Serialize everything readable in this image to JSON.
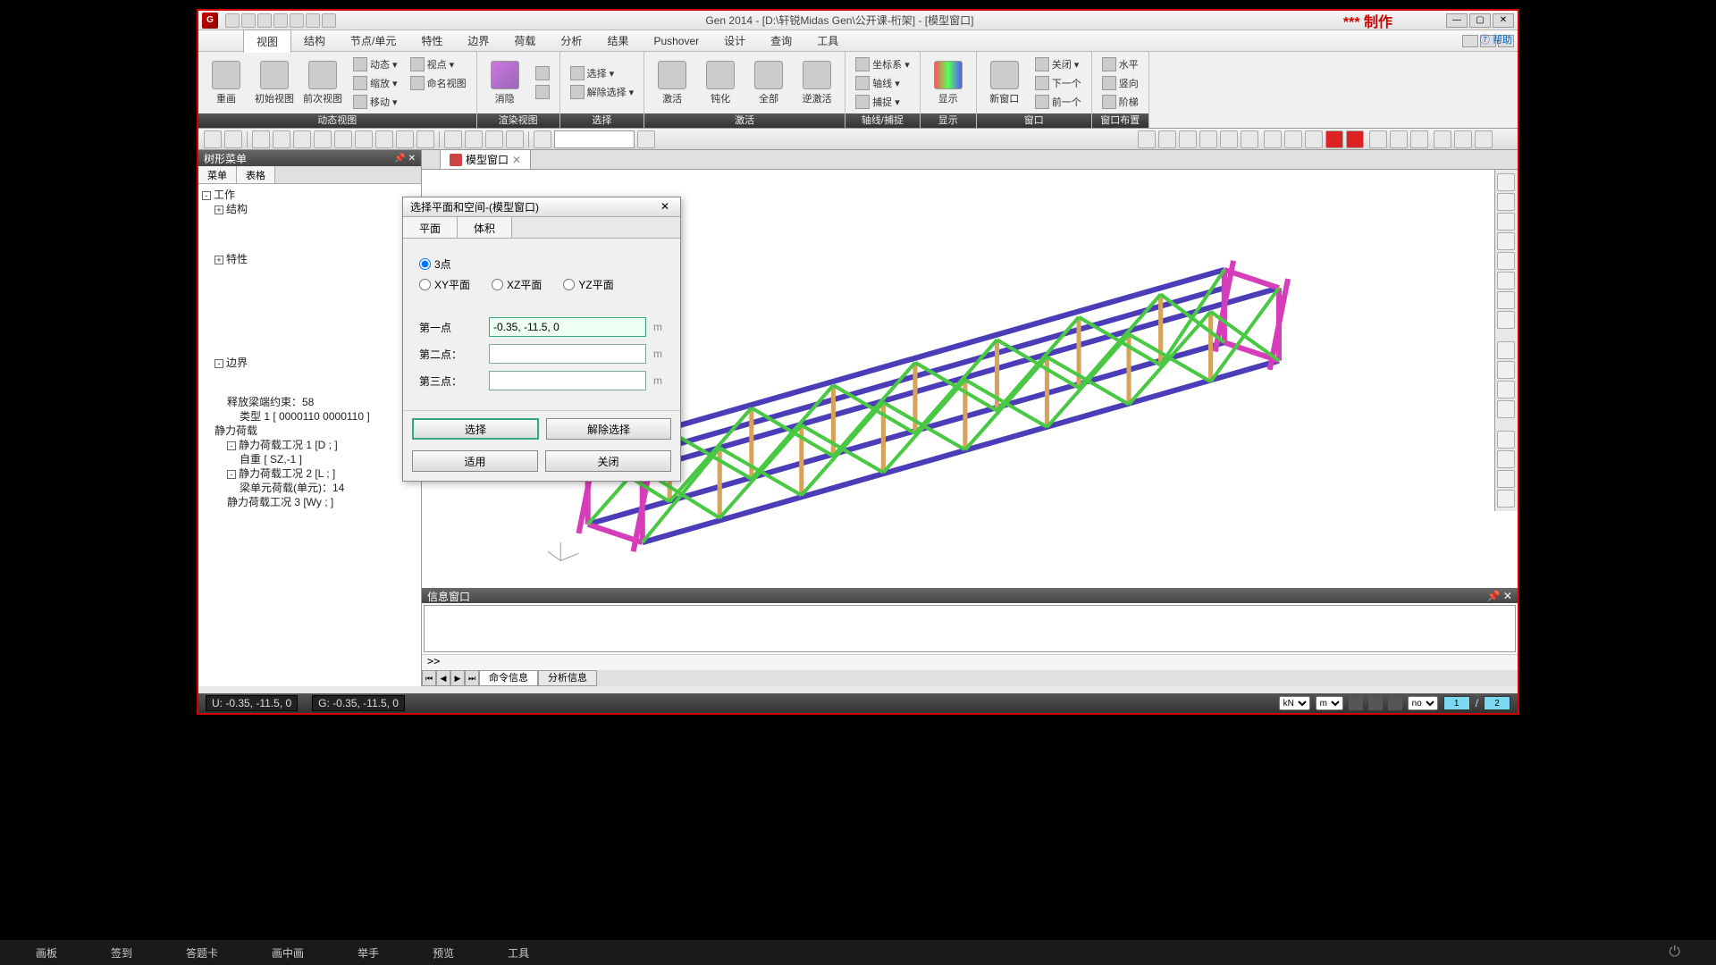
{
  "title": "Gen 2014 - [D:\\轩锐Midas Gen\\公开课-桁架] - [模型窗口]",
  "watermark": "***  制作",
  "help": "⑦ 帮助",
  "menu": [
    "视图",
    "结构",
    "节点/单元",
    "特性",
    "边界",
    "荷载",
    "分析",
    "结果",
    "Pushover",
    "设计",
    "查询",
    "工具"
  ],
  "ribbon": {
    "g1": {
      "label": "动态视图",
      "btns": {
        "redraw": "重画",
        "initview": "初始视图",
        "prevview": "前次视图",
        "dynamic": "动态 ▾",
        "viewpt": "视点 ▾",
        "zoom": "缩放 ▾",
        "nameview": "命名视图",
        "move": "移动 ▾"
      }
    },
    "g2": {
      "label": "渲染视图",
      "btns": {
        "hidden": "消隐"
      }
    },
    "g3": {
      "label": "选择",
      "btns": {
        "select": "选择 ▾",
        "unselect": "解除选择 ▾"
      }
    },
    "g4": {
      "label": "激活",
      "btns": {
        "activate": "激活",
        "passivate": "钝化",
        "all": "全部",
        "invact": "逆激活"
      }
    },
    "g5": {
      "label": "轴线/捕捉",
      "btns": {
        "ucs": "坐标系 ▾",
        "grid": "轴线 ▾",
        "snap": "捕捉 ▾"
      }
    },
    "g6": {
      "label": "显示",
      "btns": {
        "display": "显示"
      }
    },
    "g7": {
      "label": "窗口",
      "btns": {
        "newwin": "新窗口",
        "close": "关闭 ▾",
        "next": "下一个",
        "prev": "前一个"
      }
    },
    "g8": {
      "label": "窗口布置",
      "btns": {
        "horiz": "水平",
        "vert": "竖向",
        "stair": "阶梯"
      }
    }
  },
  "leftPanel": {
    "title": "树形菜单",
    "tabs": [
      "菜单",
      "表格"
    ],
    "tree": {
      "n1": "工作",
      "n2": "结构",
      "n3": "特性",
      "n4": "边界",
      "n5": "释放梁端约束：58",
      "n6": "类型 1 [ 0000110 0000110 ]",
      "n7": "静力荷载",
      "n8": "静力荷载工况 1 [D ; ]",
      "n9": "自重 [ SZ,-1 ]",
      "n10": "静力荷载工况 2 [L ; ]",
      "n11": "梁单元荷载(单元)：14",
      "n12": "静力荷载工况 3 [Wy ; ]"
    }
  },
  "docTab": "模型窗口",
  "dialog": {
    "title": "选择平面和空间-(模型窗口)",
    "tab1": "平面",
    "tab2": "体积",
    "r1": "3点",
    "r2": "XY平面",
    "r3": "XZ平面",
    "r4": "YZ平面",
    "p1": "第一点",
    "p2": "第二点：",
    "p3": "第三点：",
    "p1val": "-0.35, -11.5, 0",
    "p2val": "",
    "p3val": "",
    "unit": "m",
    "btnSelect": "选择",
    "btnUnselect": "解除选择",
    "btnApply": "适用",
    "btnClose": "关闭"
  },
  "infoPanel": {
    "title": "信息窗口",
    "prompt": ">>",
    "tab1": "命令信息",
    "tab2": "分析信息"
  },
  "status": {
    "u": "U: -0.35, -11.5, 0",
    "g": "G: -0.35, -11.5, 0",
    "unit1": "kN",
    "unit2": "m",
    "no": "no",
    "one": "1",
    "two": "2"
  },
  "bottomBar": [
    "画板",
    "签到",
    "答题卡",
    "画中画",
    "举手",
    "预览",
    "工具"
  ]
}
